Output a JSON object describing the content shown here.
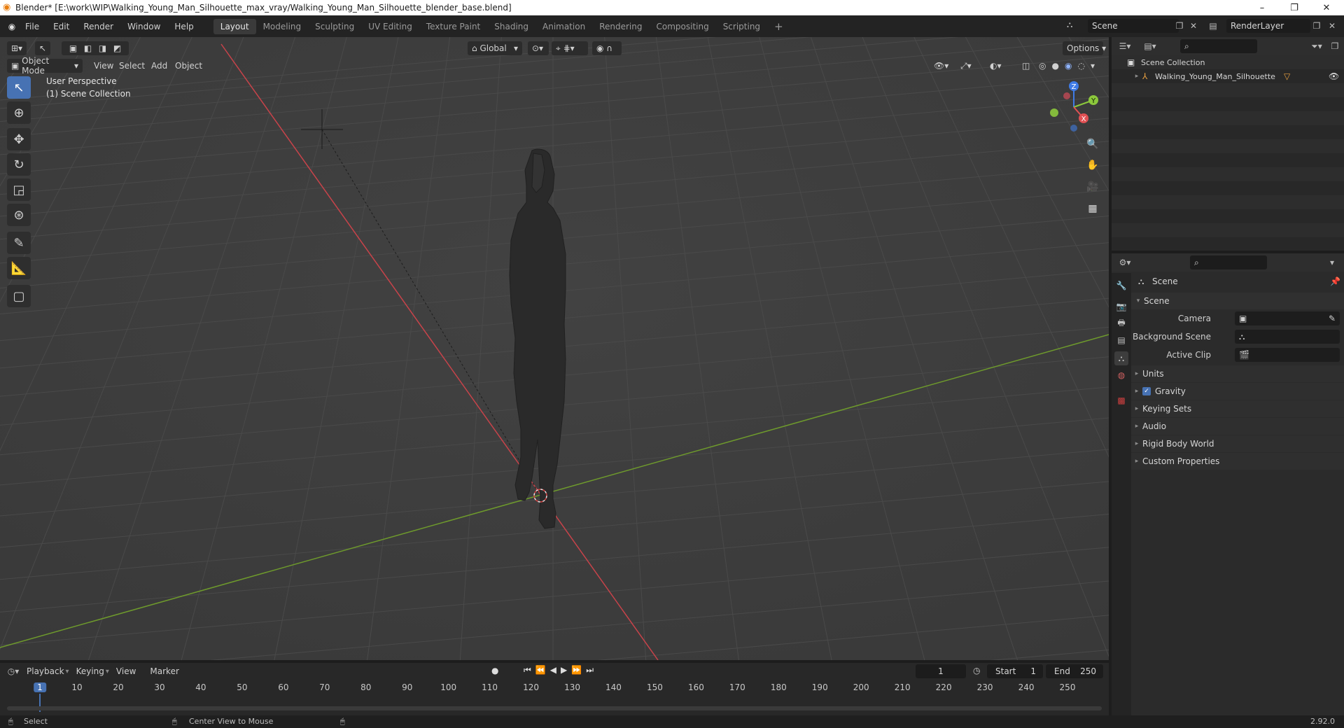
{
  "window": {
    "title": "Blender* [E:\\work\\WIP\\Walking_Young_Man_Silhouette_max_vray/Walking_Young_Man_Silhouette_blender_base.blend]",
    "controls": [
      "–",
      "❐",
      "✕"
    ]
  },
  "menubar": {
    "menus": [
      "File",
      "Edit",
      "Render",
      "Window",
      "Help"
    ],
    "workspaces": [
      "Layout",
      "Modeling",
      "Sculpting",
      "UV Editing",
      "Texture Paint",
      "Shading",
      "Animation",
      "Rendering",
      "Compositing",
      "Scripting"
    ],
    "active_workspace": "Layout",
    "add_tab": "+",
    "scene_name": "Scene",
    "view_layer": "RenderLayer"
  },
  "viewport": {
    "mode": "Object Mode",
    "menus": [
      "View",
      "Select",
      "Add",
      "Object"
    ],
    "transform_orientation": "Global",
    "options_label": "Options",
    "overlay_line1": "User Perspective",
    "overlay_line2": "(1) Scene Collection",
    "gizmo_axes": [
      "X",
      "Y",
      "Z"
    ]
  },
  "outliner": {
    "root": "Scene Collection",
    "items": [
      {
        "name": "Walking_Young_Man_Silhouette"
      }
    ]
  },
  "properties": {
    "context": "Scene",
    "panel_title": "Scene",
    "fields": [
      {
        "label": "Camera",
        "value": ""
      },
      {
        "label": "Background Scene",
        "value": ""
      },
      {
        "label": "Active Clip",
        "value": ""
      }
    ],
    "subpanels": [
      "Units",
      "Gravity",
      "Keying Sets",
      "Audio",
      "Rigid Body World",
      "Custom Properties"
    ],
    "gravity_checked": true
  },
  "timeline": {
    "menus": [
      "Playback",
      "Keying",
      "View",
      "Marker"
    ],
    "current_frame": "1",
    "start_label": "Start",
    "start_value": "1",
    "end_label": "End",
    "end_value": "250",
    "ticks": [
      "1",
      "10",
      "20",
      "30",
      "40",
      "50",
      "60",
      "70",
      "80",
      "90",
      "100",
      "110",
      "120",
      "130",
      "140",
      "150",
      "160",
      "170",
      "180",
      "190",
      "200",
      "210",
      "220",
      "230",
      "240",
      "250"
    ]
  },
  "statusbar": {
    "left": "Select",
    "middle": "Center View to Mouse",
    "version": "2.92.0"
  },
  "colors": {
    "accent": "#4772b3",
    "x_axis": "#e05053",
    "y_axis": "#8cc83c",
    "z_axis": "#3f7be6"
  }
}
